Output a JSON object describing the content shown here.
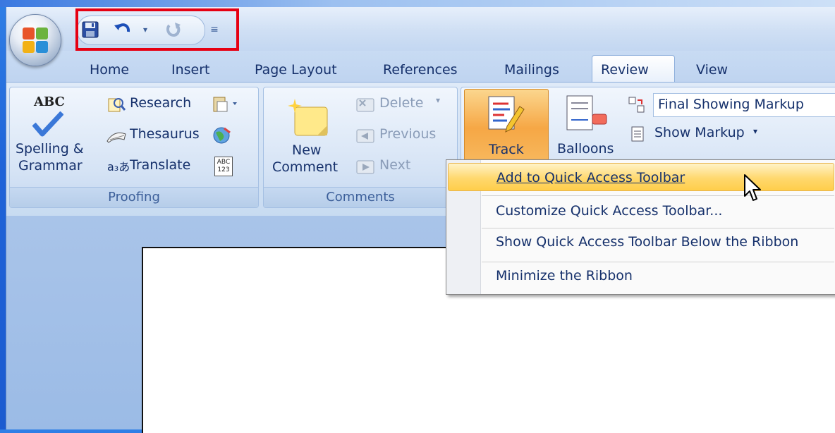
{
  "quick_access_toolbar": {
    "icons": [
      "save-icon",
      "undo-icon",
      "undo-dropdown-icon",
      "redo-icon",
      "customize-dropdown-icon"
    ]
  },
  "tabs": [
    {
      "label": "Home"
    },
    {
      "label": "Insert"
    },
    {
      "label": "Page Layout"
    },
    {
      "label": "References"
    },
    {
      "label": "Mailings"
    },
    {
      "label": "Review",
      "active": true
    },
    {
      "label": "View"
    }
  ],
  "ribbon": {
    "proofing": {
      "label": "Proofing",
      "spelling_icon_text": "ABC",
      "spelling_label_line1": "Spelling &",
      "spelling_label_line2": "Grammar",
      "research": "Research",
      "thesaurus": "Thesaurus",
      "translate": "Translate",
      "word_count_icon_text": "ABC\n123"
    },
    "comments": {
      "label": "Comments",
      "new_comment_line1": "New",
      "new_comment_line2": "Comment",
      "delete": "Delete",
      "previous": "Previous",
      "next": "Next"
    },
    "tracking": {
      "track": "Track",
      "balloons": "Balloons",
      "display_for_review": "Final Showing Markup",
      "show_markup": "Show Markup"
    }
  },
  "context_menu": {
    "items": [
      {
        "label": "Add to Quick Access Toolbar",
        "hover": true
      },
      {
        "label": "Customize Quick Access Toolbar..."
      },
      {
        "label": "Show Quick Access Toolbar Below the Ribbon"
      },
      {
        "label": "Minimize the Ribbon"
      }
    ]
  },
  "colors": {
    "highlight_box": "#e60012",
    "menu_hover": "#ffd86e",
    "ribbon_text": "#15306b"
  }
}
